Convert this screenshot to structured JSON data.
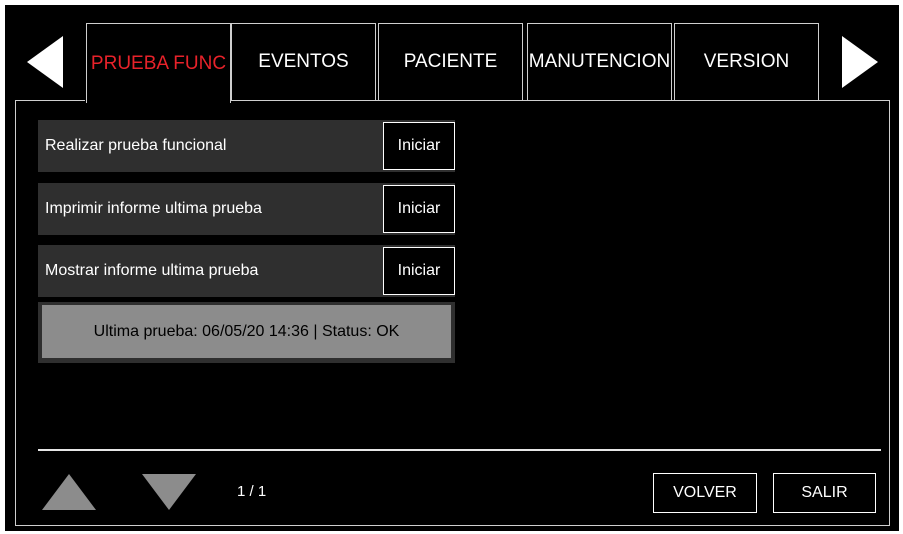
{
  "tabs": [
    {
      "label": "PRUEBA FUNC",
      "active": true
    },
    {
      "label": "EVENTOS",
      "active": false
    },
    {
      "label": "PACIENTE",
      "active": false
    },
    {
      "label": "MANUTENCION",
      "active": false
    },
    {
      "label": "VERSION",
      "active": false
    }
  ],
  "icons": {
    "tab_prev": "triangle-left-icon",
    "tab_next": "triangle-right-icon",
    "scroll_up": "triangle-up-icon",
    "scroll_down": "triangle-down-icon"
  },
  "rows": [
    {
      "label": "Realizar prueba funcional",
      "button": "Iniciar"
    },
    {
      "label": "Imprimir informe ultima prueba",
      "button": "Iniciar"
    },
    {
      "label": "Mostrar informe ultima prueba",
      "button": "Iniciar"
    }
  ],
  "status": {
    "text": "Ultima prueba: 06/05/20 14:36 | Status: OK"
  },
  "pagination": {
    "text": "1 / 1"
  },
  "footer": {
    "back_label": "VOLVER",
    "exit_label": "SALIR"
  },
  "colors": {
    "active_tab": "#e8222a",
    "background": "#000000",
    "row_bg": "#2f2f2f",
    "status_bg": "#8c8c8c"
  }
}
